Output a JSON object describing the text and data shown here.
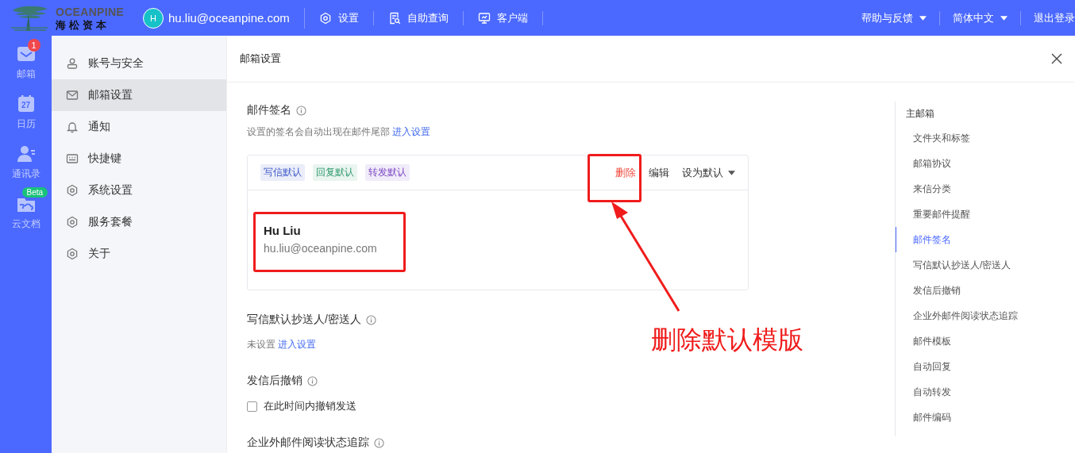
{
  "topbar": {
    "logo": {
      "title": "OCEANPINE",
      "subtitle": "海松资本"
    },
    "account": {
      "avatar": "H",
      "email": "hu.liu@oceanpine.com"
    },
    "links": [
      {
        "label": "设置"
      },
      {
        "label": "自助查询"
      },
      {
        "label": "客户端"
      }
    ],
    "menus": [
      {
        "label": "帮助与反馈"
      },
      {
        "label": "简体中文"
      }
    ],
    "logout": "退出登录"
  },
  "rail": [
    {
      "label": "邮箱",
      "badge": {
        "text": "1",
        "kind": "count"
      }
    },
    {
      "label": "日历",
      "day": "27"
    },
    {
      "label": "通讯录"
    },
    {
      "label": "云文档",
      "badge": {
        "text": "Beta",
        "kind": "tag"
      }
    }
  ],
  "settings_nav": [
    {
      "label": "账号与安全",
      "selected": false
    },
    {
      "label": "邮箱设置",
      "selected": true
    },
    {
      "label": "通知",
      "selected": false
    },
    {
      "label": "快捷键",
      "selected": false
    },
    {
      "label": "系统设置",
      "selected": false
    },
    {
      "label": "服务套餐",
      "selected": false
    },
    {
      "label": "关于",
      "selected": false
    }
  ],
  "panel": {
    "title": "邮箱设置",
    "signature": {
      "title": "邮件签名",
      "desc": "设置的签名会自动出现在邮件尾部",
      "link": "进入设置",
      "tags": [
        {
          "label": "写信默认",
          "color": "#3d57c9"
        },
        {
          "label": "回复默认",
          "color": "#2f9a6e"
        },
        {
          "label": "转发默认",
          "color": "#7a45c4"
        }
      ],
      "actions": [
        {
          "label": "删除",
          "kind": "danger"
        },
        {
          "label": "编辑",
          "kind": "plain"
        },
        {
          "label": "设为默认",
          "kind": "dropdown"
        }
      ],
      "name": "Hu Liu",
      "email": "hu.liu@oceanpine.com"
    },
    "cc": {
      "title": "写信默认抄送人/密送人",
      "value": "未设置",
      "link": "进入设置"
    },
    "recall": {
      "title": "发信后撤销",
      "checkbox": {
        "label": "在此时间内撤销发送",
        "checked": false
      }
    },
    "tracking": {
      "title": "企业外邮件阅读状态追踪"
    }
  },
  "right_nav": {
    "header": "主邮箱",
    "items": [
      {
        "label": "文件夹和标签",
        "selected": false
      },
      {
        "label": "邮箱协议",
        "selected": false
      },
      {
        "label": "来信分类",
        "selected": false
      },
      {
        "label": "重要邮件提醒",
        "selected": false
      },
      {
        "label": "邮件签名",
        "selected": true
      },
      {
        "label": "写信默认抄送人/密送人",
        "selected": false
      },
      {
        "label": "发信后撤销",
        "selected": false
      },
      {
        "label": "企业外邮件阅读状态追踪",
        "selected": false
      },
      {
        "label": "邮件模板",
        "selected": false
      },
      {
        "label": "自动回复",
        "selected": false
      },
      {
        "label": "自动转发",
        "selected": false
      },
      {
        "label": "邮件编码",
        "selected": false
      }
    ]
  },
  "annotation": {
    "text": "删除默认模版"
  }
}
